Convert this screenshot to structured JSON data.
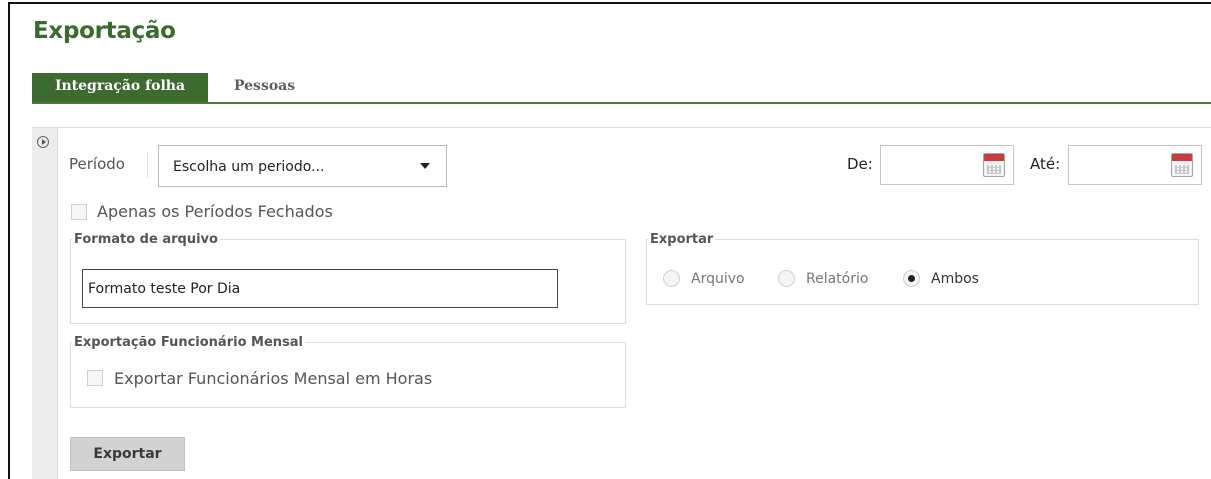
{
  "page": {
    "title": "Exportação"
  },
  "tabs": [
    {
      "label": "Integração folha",
      "active": true
    },
    {
      "label": "Pessoas",
      "active": false
    }
  ],
  "filter": {
    "periodo_label": "Período",
    "periodo_selected": "Escolha um periodo...",
    "de_label": "De:",
    "de_value": "",
    "ate_label": "Até:",
    "ate_value": "",
    "fechados_label": "Apenas os Períodos Fechados",
    "fechados_checked": false
  },
  "formato": {
    "legend": "Formato de arquivo",
    "value": "Formato teste Por Dia"
  },
  "exportar_group": {
    "legend": "Exportar",
    "options": [
      {
        "label": "Arquivo",
        "selected": false
      },
      {
        "label": "Relatório",
        "selected": false
      },
      {
        "label": "Ambos",
        "selected": true
      }
    ]
  },
  "funcionario": {
    "legend": "Exportação Funcionário Mensal",
    "checkbox_label": "Exportar Funcionários Mensal em Horas",
    "checked": false
  },
  "actions": {
    "export_button": "Exportar"
  },
  "colors": {
    "accent": "#3d6a2f",
    "title": "#3a6b2e",
    "calendar": "#cc3b3b"
  }
}
